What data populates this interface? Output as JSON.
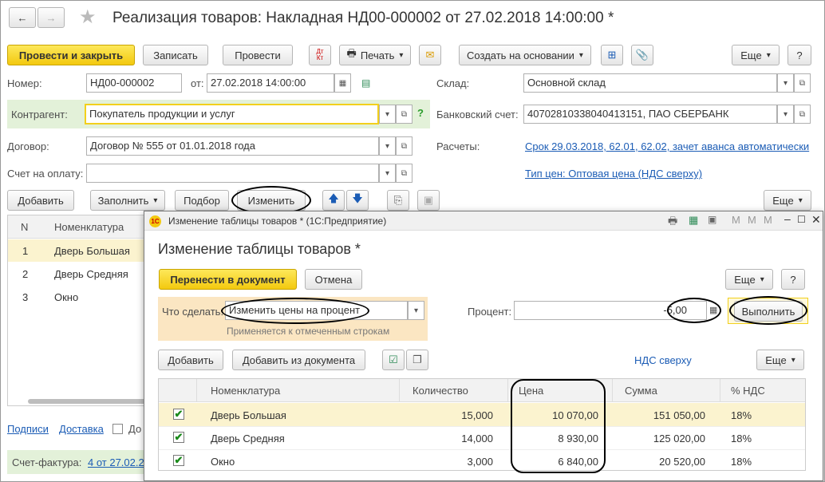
{
  "header": {
    "title": "Реализация товаров: Накладная НД00-000002 от 27.02.2018 14:00:00 *"
  },
  "toolbar": {
    "post_close": "Провести и закрыть",
    "write": "Записать",
    "post": "Провести",
    "print": "Печать",
    "create_based": "Создать на основании",
    "more": "Еще",
    "help": "?"
  },
  "form": {
    "number_label": "Номер:",
    "number_value": "НД00-000002",
    "date_label": "от:",
    "date_value": "27.02.2018 14:00:00",
    "warehouse_label": "Склад:",
    "warehouse_value": "Основной склад",
    "counterparty_label": "Контрагент:",
    "counterparty_value": "Покупатель продукции и услуг",
    "bank_label": "Банковский счет:",
    "bank_value": "40702810338040413151, ПАО СБЕРБАНК",
    "contract_label": "Договор:",
    "contract_value": "Договор № 555 от 01.01.2018 года",
    "settlements_label": "Расчеты:",
    "settlements_link": "Срок 29.03.2018, 62.01, 62.02, зачет аванса автоматически",
    "invoice_label": "Счет на оплату:",
    "invoice_value": "",
    "price_type_link": "Тип цен: Оптовая цена (НДС сверху)"
  },
  "table_toolbar": {
    "add": "Добавить",
    "fill": "Заполнить",
    "select": "Подбор",
    "change": "Изменить",
    "more": "Еще"
  },
  "main_table": {
    "col_n": "N",
    "col_item": "Номенклатура",
    "rows": [
      {
        "n": "1",
        "item": "Дверь Большая"
      },
      {
        "n": "2",
        "item": "Дверь Средняя"
      },
      {
        "n": "3",
        "item": "Окно"
      }
    ]
  },
  "footer": {
    "signatures": "Подписи",
    "delivery": "Доставка",
    "cb_label": "До",
    "invoice_label": "Счет-фактура:",
    "invoice_link": "4 от 27.02.2"
  },
  "dialog": {
    "window_title": "Изменение таблицы товаров * (1С:Предприятие)",
    "app_badge": "1С",
    "heading": "Изменение таблицы товаров *",
    "transfer": "Перенести в документ",
    "cancel": "Отмена",
    "more": "Еще",
    "help": "?",
    "action_label": "Что сделать:",
    "action_value": "Изменить цены на процент",
    "action_hint": "Применяется к отмеченным строкам",
    "percent_label": "Процент:",
    "percent_value": "-5,00",
    "execute": "Выполнить",
    "add": "Добавить",
    "add_from_doc": "Добавить из документа",
    "vat_link": "НДС сверху",
    "columns": {
      "item": "Номенклатура",
      "qty": "Количество",
      "price": "Цена",
      "sum": "Сумма",
      "vat": "% НДС"
    },
    "rows": [
      {
        "checked": true,
        "item": "Дверь Большая",
        "qty": "15,000",
        "price": "10 070,00",
        "sum": "151 050,00",
        "vat": "18%"
      },
      {
        "checked": true,
        "item": "Дверь Средняя",
        "qty": "14,000",
        "price": "8 930,00",
        "sum": "125 020,00",
        "vat": "18%"
      },
      {
        "checked": true,
        "item": "Окно",
        "qty": "3,000",
        "price": "6 840,00",
        "sum": "20 520,00",
        "vat": "18%"
      }
    ]
  },
  "colors": {
    "accent_yellow": "#f5cf1e",
    "highlight_row": "#fbf3cf",
    "link": "#1b5cb5",
    "green_field": "#e3f1d9"
  }
}
